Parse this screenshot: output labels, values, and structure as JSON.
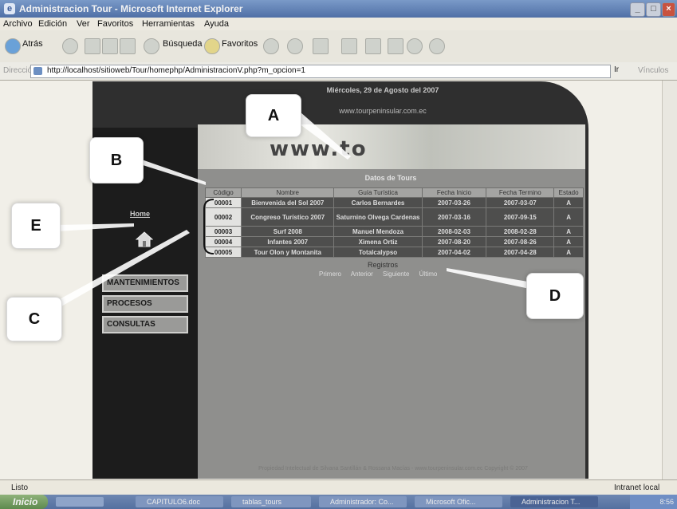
{
  "browser": {
    "title": "Administracion Tour - Microsoft Internet Explorer",
    "menu": [
      "Archivo",
      "Edición",
      "Ver",
      "Favoritos",
      "Herramientas",
      "Ayuda"
    ],
    "toolbar": {
      "back": "Atrás",
      "search": "Búsqueda",
      "favorites": "Favoritos"
    },
    "address_label": "Dirección",
    "url": "http://localhost/sitioweb/Tour/homephp/AdministracionV.php?m_opcion=1",
    "go": "Ir",
    "links": "Vínculos",
    "status_left": "Listo",
    "status_right": "Intranet local"
  },
  "site": {
    "date": "Miércoles, 29 de Agosto del 2007",
    "website": "www.tourpeninsular.com.ec",
    "banner_text": "www.to",
    "home_link": "Home",
    "menu": [
      "MANTENIMIENTOS",
      "PROCESOS",
      "CONSULTAS"
    ],
    "footer": "Propiedad Intelectual de Silvana Santillán & Rossana Macías - www.tourpeninsular.com.ec Copyright © 2007"
  },
  "table": {
    "title": "Datos de Tours",
    "headers": [
      "Código",
      "Nombre",
      "Guía Turística",
      "Fecha Inicio",
      "Fecha Termino",
      "Estado"
    ],
    "rows": [
      [
        "00001",
        "Bienvenida del Sol 2007",
        "Carlos Bernardes",
        "2007-03-26",
        "2007-03-07",
        "A"
      ],
      [
        "00002",
        "Congreso Turístico 2007",
        "Saturnino Olvega Cardenas",
        "2007-03-16",
        "2007-09-15",
        "A"
      ],
      [
        "00003",
        "Surf 2008",
        "Manuel Mendoza",
        "2008-02-03",
        "2008-02-28",
        "A"
      ],
      [
        "00004",
        "Infantes 2007",
        "Ximena Ortiz",
        "2007-08-20",
        "2007-08-26",
        "A"
      ],
      [
        "00005",
        "Tour Olon y Montanita",
        "Totalcalypso",
        "2007-04-02",
        "2007-04-28",
        "A"
      ]
    ]
  },
  "pagination": {
    "title": "Registros",
    "links": [
      "Primero",
      "Anterior",
      "Siguiente",
      "Último"
    ]
  },
  "annotations": [
    "A",
    "B",
    "C",
    "D",
    "E"
  ],
  "taskbar": {
    "start": "Inicio",
    "tasks": [
      "CAPITULO6.doc",
      "tablas_tours",
      "Administrador: Co...",
      "Microsoft Ofic...",
      "Administracion T..."
    ],
    "clock": "8:56"
  }
}
